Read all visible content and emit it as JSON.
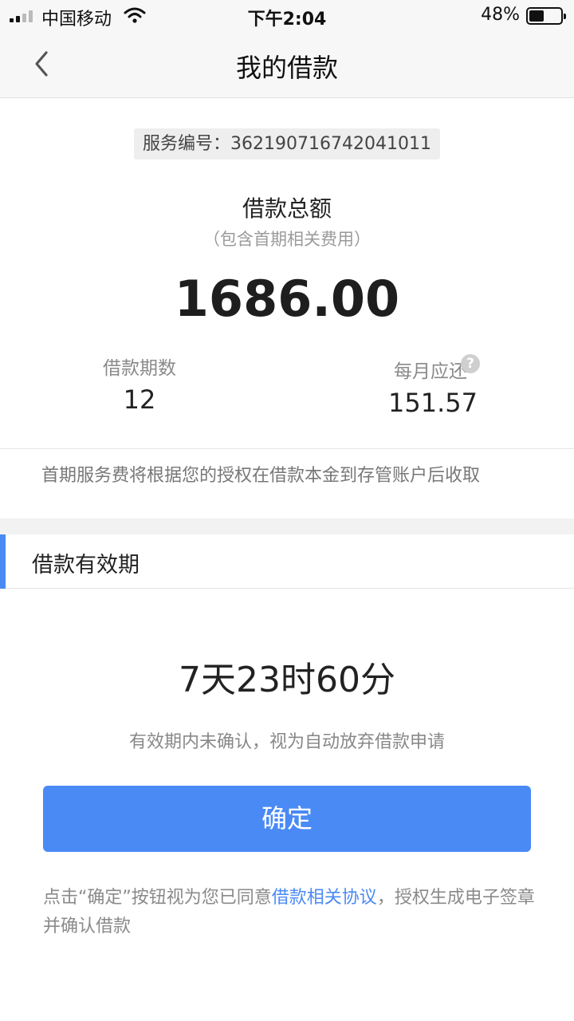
{
  "status_bar": {
    "carrier": "中国移动",
    "time": "下午2:04",
    "battery_percent_text": "48%",
    "battery_level": 0.48,
    "signal_bars_filled": 2,
    "signal_bars_total": 4
  },
  "nav": {
    "title": "我的借款",
    "back_icon": "chevron-left-icon"
  },
  "summary": {
    "service_number_label": "服务编号：",
    "service_number": "362190716742041011",
    "total_label": "借款总额",
    "total_note": "（包含首期相关费用）",
    "total_amount": "1686.00",
    "term_label": "借款期数",
    "term_value": "12",
    "monthly_label": "每月应还",
    "monthly_help_icon": "question-circle-icon",
    "monthly_help_glyph": "?",
    "monthly_value": "151.57",
    "fee_note": "首期服务费将根据您的授权在借款本金到存管账户后收取"
  },
  "validity": {
    "title": "借款有效期",
    "countdown": "7天23时60分",
    "note": "有效期内未确认，视为自动放弃借款申请"
  },
  "confirm_button": {
    "label": "确定"
  },
  "agreement": {
    "prefix": "点击“确定”按钮视为您已同意",
    "link": "借款相关协议",
    "suffix": "，授权生成电子签章并确认借款"
  },
  "colors": {
    "accent": "#4a8af5",
    "background": "#ffffff",
    "nav_background": "#f7f7f7"
  }
}
